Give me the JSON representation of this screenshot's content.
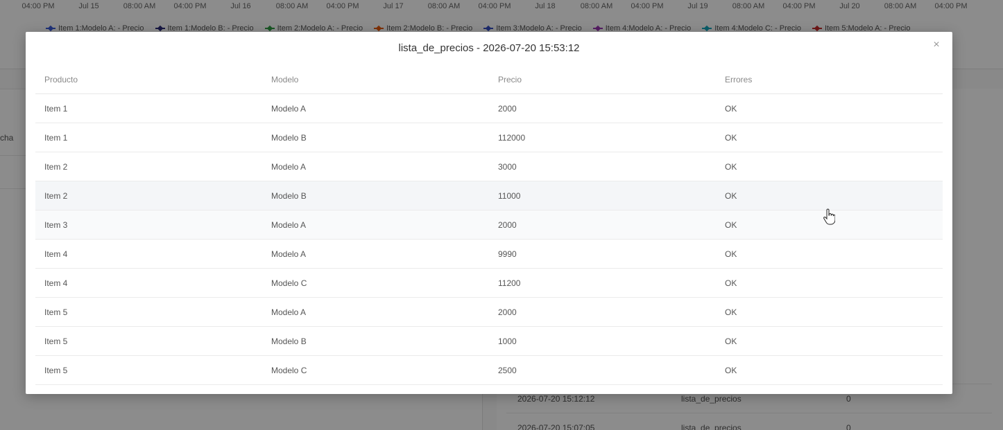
{
  "chart": {
    "x_ticks": [
      "04:00 PM",
      "Jul 15",
      "08:00 AM",
      "04:00 PM",
      "Jul 16",
      "08:00 AM",
      "04:00 PM",
      "Jul 17",
      "08:00 AM",
      "04:00 PM",
      "Jul 18",
      "08:00 AM",
      "04:00 PM",
      "Jul 19",
      "08:00 AM",
      "04:00 PM",
      "Jul 20",
      "08:00 AM",
      "04:00 PM"
    ],
    "legend": [
      {
        "label": "Item 1:Modelo A: - Precio",
        "color": "#3b5bdb"
      },
      {
        "label": "Item 1:Modelo B: - Precio",
        "color": "#2a2a7a"
      },
      {
        "label": "Item 2:Modelo A: - Precio",
        "color": "#2f9e44"
      },
      {
        "label": "Item 2:Modelo B: - Precio",
        "color": "#e8590c"
      },
      {
        "label": "Item 3:Modelo A: - Precio",
        "color": "#364fc7"
      },
      {
        "label": "Item 4:Modelo A: - Precio",
        "color": "#9c36b5"
      },
      {
        "label": "Item 4:Modelo C: - Precio",
        "color": "#15aabf"
      },
      {
        "label": "Item 5:Modelo A: - Precio",
        "color": "#c92a2a"
      }
    ]
  },
  "background": {
    "left_label": "cha",
    "history_rows": [
      {
        "date": "2026-07-20 15:12:12",
        "name": "lista_de_precios",
        "errors": "0"
      },
      {
        "date": "2026-07-20 15:07:05",
        "name": "lista_de_precios",
        "errors": "0"
      }
    ]
  },
  "modal": {
    "title": "lista_de_precios - 2026-07-20 15:53:12",
    "close_glyph": "×",
    "columns": [
      "Producto",
      "Modelo",
      "Precio",
      "Errores"
    ],
    "rows": [
      {
        "producto": "Item 1",
        "modelo": "Modelo A",
        "precio": "2000",
        "errores": "OK"
      },
      {
        "producto": "Item 1",
        "modelo": "Modelo B",
        "precio": "112000",
        "errores": "OK"
      },
      {
        "producto": "Item 2",
        "modelo": "Modelo A",
        "precio": "3000",
        "errores": "OK"
      },
      {
        "producto": "Item 2",
        "modelo": "Modelo B",
        "precio": "11000",
        "errores": "OK"
      },
      {
        "producto": "Item 3",
        "modelo": "Modelo A",
        "precio": "2000",
        "errores": "OK"
      },
      {
        "producto": "Item 4",
        "modelo": "Modelo A",
        "precio": "9990",
        "errores": "OK"
      },
      {
        "producto": "Item 4",
        "modelo": "Modelo C",
        "precio": "11200",
        "errores": "OK"
      },
      {
        "producto": "Item 5",
        "modelo": "Modelo A",
        "precio": "2000",
        "errores": "OK"
      },
      {
        "producto": "Item 5",
        "modelo": "Modelo B",
        "precio": "1000",
        "errores": "OK"
      },
      {
        "producto": "Item 5",
        "modelo": "Modelo C",
        "precio": "2500",
        "errores": "OK"
      }
    ]
  }
}
